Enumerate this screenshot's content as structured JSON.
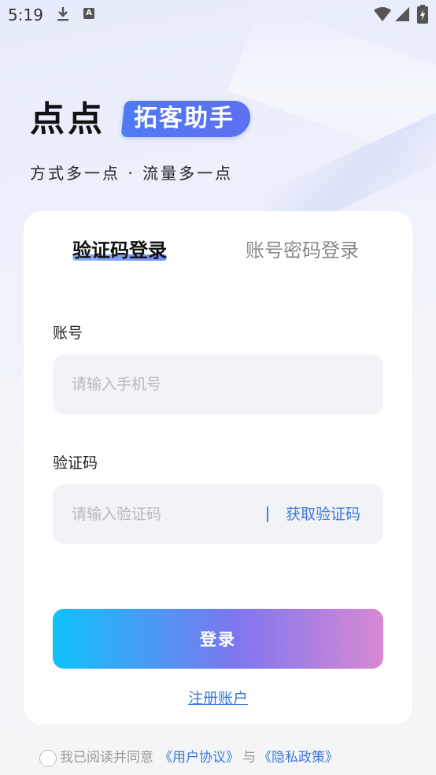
{
  "status_bar": {
    "time": "5:19",
    "icons": [
      "download-icon",
      "a-icon",
      "wifi-icon",
      "signal-icon",
      "battery-icon"
    ],
    "a_icon_glyph": "A"
  },
  "brand": {
    "main": "点点",
    "pill": "拓客助手",
    "slogan": "方式多一点 · 流量多一点",
    "pill_color": "#5b74f2"
  },
  "tabs": [
    {
      "label": "验证码登录",
      "active": true
    },
    {
      "label": "账号密码登录",
      "active": false
    }
  ],
  "form": {
    "account_label": "账号",
    "account_placeholder": "请输入手机号",
    "account_value": "",
    "code_label": "验证码",
    "code_placeholder": "请输入验证码",
    "code_value": "",
    "get_code_label": "获取验证码"
  },
  "actions": {
    "login_label": "登录",
    "register_label": "注册账户"
  },
  "agreement": {
    "checked": false,
    "prefix": "我已阅读并同意",
    "user_agreement": "《用户协议》",
    "and": "与",
    "privacy_policy": "《隐私政策》"
  },
  "colors": {
    "link": "#3f78d8",
    "login_gradient": [
      "#0fc2fb",
      "#7d76f0",
      "#d889d3"
    ]
  }
}
